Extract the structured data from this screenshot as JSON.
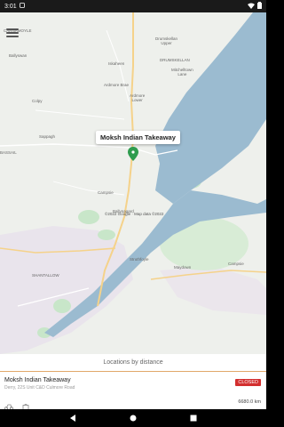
{
  "status_bar": {
    "time": "3:01"
  },
  "map": {
    "labels": {
      "carnamoyle": "CARNAMOYLE",
      "ballyswan": "Ballyswan",
      "drumskellan": "Drumskellan\nUpper",
      "iskaheen": "Iskaheen",
      "drumskellan_caps": "DRUMSKELLAN",
      "mitchelltown": "Mitchelltown\nLane",
      "ardmore_brae": "Ardmore Brae",
      "ardmore_lower": "Ardmore\nLower",
      "colpy": "Colpy",
      "sappagh": "Sappagh",
      "bassaill": "BASSAIL",
      "campsie_mid": "Campsie",
      "ballynagard": "Ballynagard",
      "struthfoyle": "Struthfoyle",
      "maydown": "Maydown",
      "campsie": "Campsie",
      "shantallow": "SHANTALLOW"
    },
    "attribution": "©2022 Google · Map data ©2022",
    "marker_popup": "Moksh Indian Takeaway"
  },
  "panel": {
    "header": "Locations by distance",
    "locations": [
      {
        "name": "Moksh Indian Takeaway",
        "address": "Derry, 22S Unit C&D Culmore Road",
        "status": "CLOSED",
        "distance": "6680.0 km"
      }
    ]
  },
  "colors": {
    "water": "#9bbbd0",
    "land": "#eef0ec",
    "park": "#c8e6c9",
    "urban": "#e9e4ec",
    "road": "#f5d28a",
    "accent": "#e1a86a",
    "closed": "#d32f2f",
    "marker": "#2e9c4e"
  }
}
